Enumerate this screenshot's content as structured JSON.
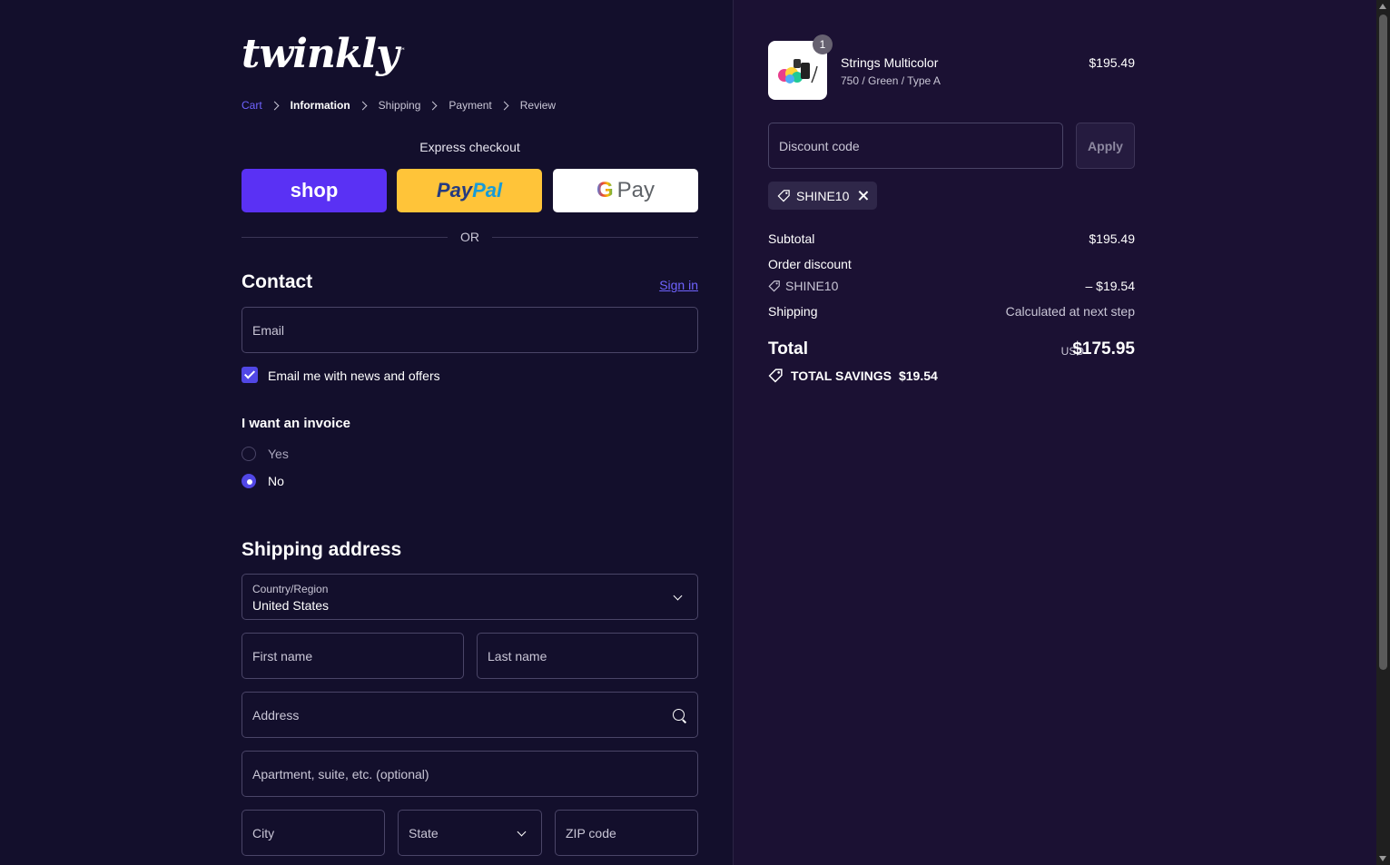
{
  "brand": {
    "logo_text": "twinkly",
    "trademark": "™"
  },
  "breadcrumb": {
    "items": [
      {
        "label": "Cart",
        "state": "link"
      },
      {
        "label": "Information",
        "state": "active"
      },
      {
        "label": "Shipping",
        "state": "normal"
      },
      {
        "label": "Payment",
        "state": "normal"
      },
      {
        "label": "Review",
        "state": "normal"
      }
    ]
  },
  "express": {
    "label": "Express checkout",
    "shop_label": "shop",
    "paypal_part1": "Pay",
    "paypal_part2": "Pal",
    "gpay_g": "G",
    "gpay_label": "Pay",
    "or": "OR"
  },
  "contact": {
    "title": "Contact",
    "signin": "Sign in",
    "email_placeholder": "Email",
    "newsletter_label": "Email me with news and offers",
    "newsletter_checked": true
  },
  "invoice": {
    "title": "I want an invoice",
    "options": [
      {
        "label": "Yes",
        "selected": false
      },
      {
        "label": "No",
        "selected": true
      }
    ]
  },
  "shipping": {
    "title": "Shipping address",
    "country_label": "Country/Region",
    "country_value": "United States",
    "first_name": "First name",
    "last_name": "Last name",
    "address": "Address",
    "apartment": "Apartment, suite, etc. (optional)",
    "city": "City",
    "state": "State",
    "zip": "ZIP code"
  },
  "order": {
    "item": {
      "name": "Strings Multicolor",
      "variant": "750 / Green / Type A",
      "price": "$195.49",
      "quantity": "1"
    },
    "discount_placeholder": "Discount code",
    "apply_label": "Apply",
    "applied_code": "SHINE10",
    "subtotal_label": "Subtotal",
    "subtotal_value": "$195.49",
    "order_discount_label": "Order discount",
    "discount_code": "SHINE10",
    "discount_value": "– $19.54",
    "shipping_label": "Shipping",
    "shipping_value": "Calculated at next step",
    "total_label": "Total",
    "currency": "USD",
    "total_value": "$175.95",
    "savings_label": "TOTAL SAVINGS",
    "savings_value": "$19.54"
  },
  "colors": {
    "left_bg": "#130f2c",
    "right_bg": "#1b1133",
    "accent": "#5147e6",
    "link": "#6f63ff",
    "shop_pay": "#5a31f4",
    "paypal": "#ffc439"
  }
}
